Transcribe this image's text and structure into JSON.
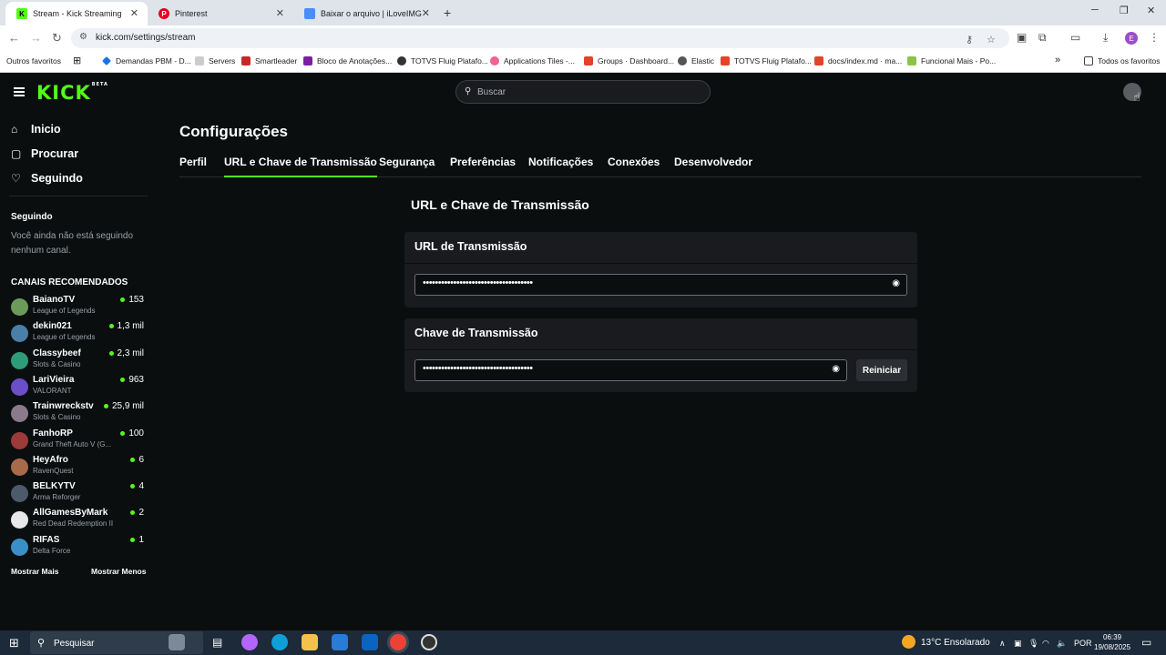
{
  "browser": {
    "tabs": [
      {
        "title": "Stream - Kick Streaming",
        "active": true
      },
      {
        "title": "Pinterest",
        "active": false
      },
      {
        "title": "Baixar o arquivo | iLoveIMG",
        "active": false
      }
    ],
    "url": "kick.com/settings/stream",
    "profile_initial": "E",
    "bookmarks": [
      "Outros favoritos",
      "Demandas PBM - D...",
      "Servers",
      "Smartleader",
      "Bloco de Anotações...",
      "TOTVS Fluig Platafo...",
      "Applications Tiles -...",
      "Groups · Dashboard...",
      "Elastic",
      "TOTVS Fluig Platafo...",
      "docs/index.md · ma...",
      "Funcional Mais - Po...",
      "Todos os favoritos"
    ]
  },
  "header": {
    "logo": "KICK",
    "logo_beta": "BETA",
    "search_placeholder": "Buscar"
  },
  "sidebar": {
    "nav": [
      "Inicio",
      "Procurar",
      "Seguindo"
    ],
    "following_title": "Seguindo",
    "following_empty": "Você ainda não está seguindo nenhum canal.",
    "recommended_title": "CANAIS RECOMENDADOS",
    "channels": [
      {
        "name": "BaianoTV",
        "category": "League of Legends",
        "viewers": "153"
      },
      {
        "name": "dekin021",
        "category": "League of Legends",
        "viewers": "1,3 mil"
      },
      {
        "name": "Classybeef",
        "category": "Slots & Casino",
        "viewers": "2,3 mil"
      },
      {
        "name": "LariVieira",
        "category": "VALORANT",
        "viewers": "963"
      },
      {
        "name": "Trainwreckstv",
        "category": "Slots & Casino",
        "viewers": "25,9 mil"
      },
      {
        "name": "FanhoRP",
        "category": "Grand Theft Auto V (G...",
        "viewers": "100"
      },
      {
        "name": "HeyAfro",
        "category": "RavenQuest",
        "viewers": "6"
      },
      {
        "name": "BELKYTV",
        "category": "Arma Reforger",
        "viewers": "4"
      },
      {
        "name": "AllGamesByMark",
        "category": "Red Dead Redemption II",
        "viewers": "2"
      },
      {
        "name": "RIFAS",
        "category": "Delta Force",
        "viewers": "1"
      }
    ],
    "show_more": "Mostrar Mais",
    "show_less": "Mostrar Menos"
  },
  "main": {
    "title": "Configurações",
    "tabs": [
      "Perfil",
      "URL e Chave de Transmissão",
      "Segurança",
      "Preferências",
      "Notificações",
      "Conexões",
      "Desenvolvedor"
    ],
    "active_tab": "URL e Chave de Transmissão",
    "section_title": "URL e Chave de Transmissão",
    "url_card_title": "URL de Transmissão",
    "url_value": "••••••••••••••••••••••••••••••••••••",
    "key_card_title": "Chave de Transmissão",
    "key_value": "••••••••••••••••••••••••••••••••••••",
    "reset_label": "Reiniciar"
  },
  "taskbar": {
    "search_placeholder": "Pesquisar",
    "weather": "13°C  Ensolarado",
    "language": "POR",
    "time": "06:39",
    "date": "19/08/2025"
  },
  "colors": {
    "accent": "#53fc18",
    "background": "#0b0e0f",
    "card": "#191b1f"
  }
}
